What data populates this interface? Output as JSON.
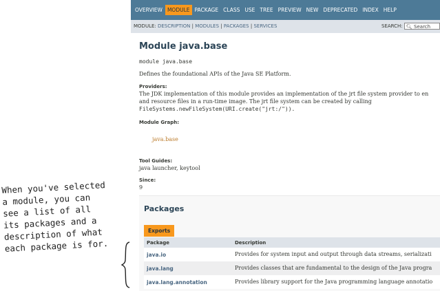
{
  "nav": {
    "items": [
      "OVERVIEW",
      "MODULE",
      "PACKAGE",
      "CLASS",
      "USE",
      "TREE",
      "PREVIEW",
      "NEW",
      "DEPRECATED",
      "INDEX",
      "HELP"
    ],
    "active": "MODULE"
  },
  "subnav": {
    "prefix": "MODULE:",
    "links": [
      "DESCRIPTION",
      "MODULES",
      "PACKAGES",
      "SERVICES"
    ],
    "separator": "|",
    "search_label": "SEARCH:",
    "search_placeholder": "Search"
  },
  "module": {
    "title": "Module java.base",
    "declaration": "module java.base",
    "description": "Defines the foundational APIs of the Java SE Platform.",
    "providers_label": "Providers:",
    "providers_line1": "The JDK implementation of this module provides an implementation of the jrt file system provider to en",
    "providers_line2": "and resource files in a run-time image. The jrt file system can be created by calling",
    "providers_code": "FileSystems.newFileSystem(URI.create(\"jrt:/\")).",
    "graph_label": "Module Graph:",
    "graph_node": "java.base",
    "tool_guides_label": "Tool Guides:",
    "tool_guides_value": "java launcher, keytool",
    "since_label": "Since:",
    "since_value": "9"
  },
  "packages": {
    "title": "Packages",
    "tab": "Exports",
    "columns": [
      "Package",
      "Description"
    ],
    "rows": [
      {
        "package": "java.io",
        "description": "Provides for system input and output through data streams, serializati"
      },
      {
        "package": "java.lang",
        "description": "Provides classes that are fundamental to the design of the Java progra"
      },
      {
        "package": "java.lang.annotation",
        "description": "Provides library support for the Java programming language annotatio"
      }
    ]
  },
  "annotation": {
    "lines": [
      "When you've selected",
      "a module, you can",
      "see a list of all",
      "its packages and a",
      "description of what",
      "each package is for."
    ]
  },
  "colors": {
    "nav_bg": "#4d7a97",
    "active_tab": "#f8981d",
    "subnav_bg": "#dee3e9",
    "link": "#4a6782"
  }
}
